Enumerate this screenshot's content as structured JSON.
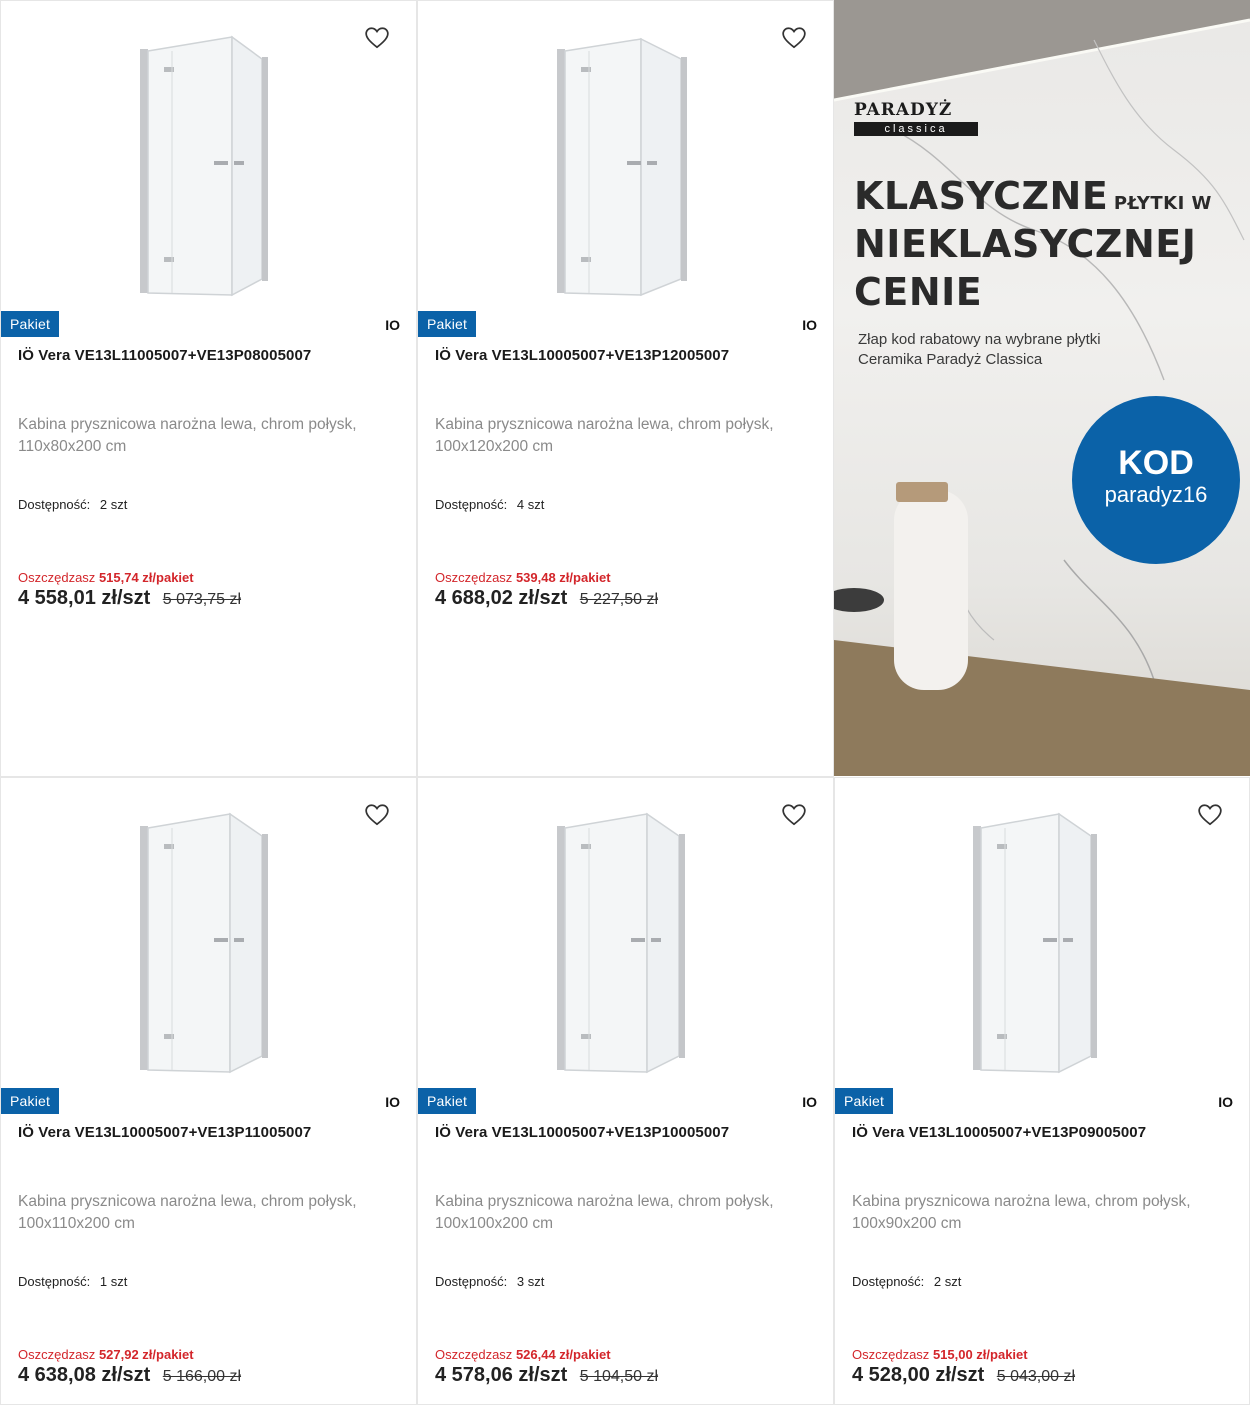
{
  "promo": {
    "logo_main": "PARADYŻ",
    "logo_sub": "classica",
    "headline_1": "KLASYCZNE",
    "headline_1b": "PŁYTKI W",
    "headline_2": "NIEKLASYCZNEJ",
    "headline_3": "CENIE",
    "subtext": "Złap kod rabatowy na wybrane płytki Ceramika Paradyż Classica",
    "code_label": "KOD",
    "code_value": "paradyz16",
    "accent_color": "#0b62a8"
  },
  "products": [
    {
      "badge": "Pakiet",
      "brand": "IO",
      "title": "IÖ Vera VE13L11005007+VE13P08005007",
      "description": "Kabina prysznicowa narożna lewa, chrom połysk, 110x80x200 cm",
      "availability_label": "Dostępność:",
      "availability_value": "2 szt",
      "save_label": "Oszczędzasz",
      "save_value": "515,74 zł/pakiet",
      "price": "4 558,01 zł/szt",
      "old_price": "5 073,75 zł",
      "icon": "heart-icon"
    },
    {
      "badge": "Pakiet",
      "brand": "IO",
      "title": "IÖ Vera VE13L10005007+VE13P12005007",
      "description": "Kabina prysznicowa narożna lewa, chrom połysk, 100x120x200 cm",
      "availability_label": "Dostępność:",
      "availability_value": "4 szt",
      "save_label": "Oszczędzasz",
      "save_value": "539,48 zł/pakiet",
      "price": "4 688,02 zł/szt",
      "old_price": "5 227,50 zł",
      "icon": "heart-icon"
    },
    {
      "badge": "Pakiet",
      "brand": "IO",
      "title": "IÖ Vera VE13L10005007+VE13P11005007",
      "description": "Kabina prysznicowa narożna lewa, chrom połysk, 100x110x200 cm",
      "availability_label": "Dostępność:",
      "availability_value": "1 szt",
      "save_label": "Oszczędzasz",
      "save_value": "527,92 zł/pakiet",
      "price": "4 638,08 zł/szt",
      "old_price": "5 166,00 zł",
      "icon": "heart-icon"
    },
    {
      "badge": "Pakiet",
      "brand": "IO",
      "title": "IÖ Vera VE13L10005007+VE13P10005007",
      "description": "Kabina prysznicowa narożna lewa, chrom połysk, 100x100x200 cm",
      "availability_label": "Dostępność:",
      "availability_value": "3 szt",
      "save_label": "Oszczędzasz",
      "save_value": "526,44 zł/pakiet",
      "price": "4 578,06 zł/szt",
      "old_price": "5 104,50 zł",
      "icon": "heart-icon"
    },
    {
      "badge": "Pakiet",
      "brand": "IO",
      "title": "IÖ Vera VE13L10005007+VE13P09005007",
      "description": "Kabina prysznicowa narożna lewa, chrom połysk, 100x90x200 cm",
      "availability_label": "Dostępność:",
      "availability_value": "2 szt",
      "save_label": "Oszczędzasz",
      "save_value": "515,00 zł/pakiet",
      "price": "4 528,00 zł/szt",
      "old_price": "5 043,00 zł",
      "icon": "heart-icon"
    }
  ]
}
